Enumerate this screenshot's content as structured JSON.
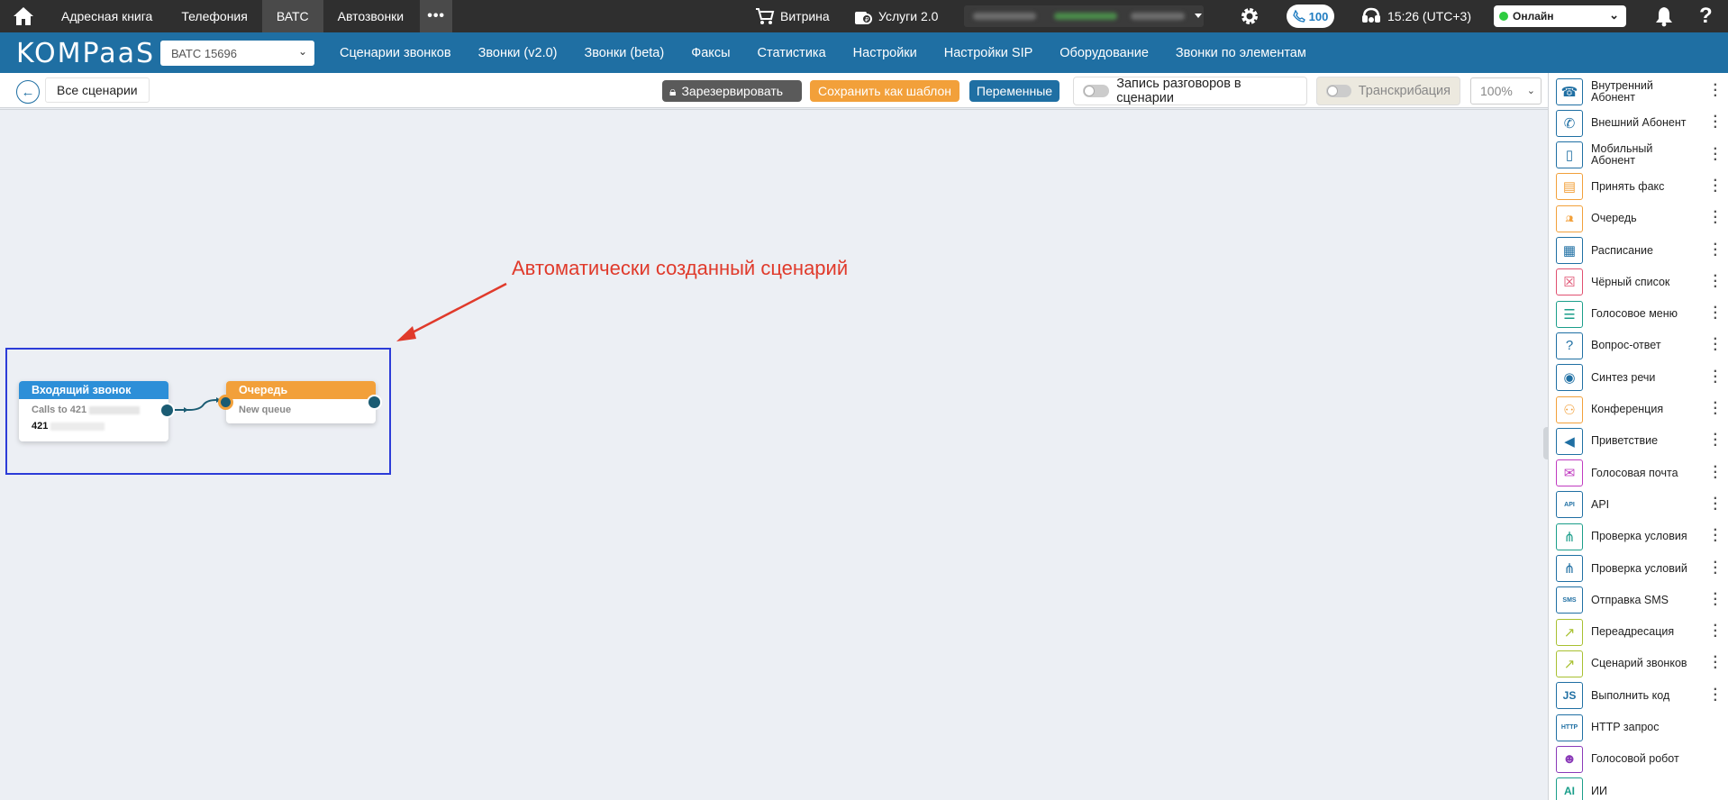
{
  "topbar": {
    "tabs": [
      {
        "label": "Адресная книга"
      },
      {
        "label": "Телефония"
      },
      {
        "label": "ВАТС"
      },
      {
        "label": "Автозвонки"
      }
    ],
    "more_label": "•••",
    "showcase_label": "Витрина",
    "services_label": "Услуги 2.0",
    "calls_count": "100",
    "time": "15:26 (UTC+3)",
    "status": "Онлайн"
  },
  "navbar": {
    "logo": "KOMPaaS",
    "pbx_select": "ВАТС 15696",
    "links": [
      {
        "label": "Сценарии звонков"
      },
      {
        "label": "Звонки (v2.0)"
      },
      {
        "label": "Звонки (beta)"
      },
      {
        "label": "Факсы"
      },
      {
        "label": "Статистика"
      },
      {
        "label": "Настройки"
      },
      {
        "label": "Настройки SIP"
      },
      {
        "label": "Оборудование"
      },
      {
        "label": "Звонки по элементам"
      }
    ]
  },
  "toolbar": {
    "all_scenarios": "Все сценарии",
    "reserve": "Зарезервировать",
    "save_template": "Сохранить как шаблон",
    "variables": "Переменные",
    "record_calls": "Запись разговоров в сценарии",
    "transcription": "Транскрибация",
    "zoom": "100%"
  },
  "canvas": {
    "annotation": "Автоматически созданный сценарий",
    "nodes": {
      "incoming": {
        "title": "Входящий звонок",
        "subtitle": "Calls to 421",
        "number": "421",
        "color": "#2d8fd8"
      },
      "queue": {
        "title": "Очередь",
        "subtitle": "New queue",
        "color": "#f2a03a"
      }
    }
  },
  "palette": {
    "items": [
      {
        "label": "Внутренний Абонент",
        "icon": "internal-subscriber-icon",
        "color": "#1f6fa3"
      },
      {
        "label": "Внешний Абонент",
        "icon": "external-subscriber-icon",
        "color": "#1f6fa3"
      },
      {
        "label": "Мобильный Абонент",
        "icon": "mobile-subscriber-icon",
        "color": "#1f6fa3"
      },
      {
        "label": "Принять факс",
        "icon": "fax-icon",
        "color": "#f2a03a"
      },
      {
        "label": "Очередь",
        "icon": "queue-icon",
        "color": "#f2a03a"
      },
      {
        "label": "Расписание",
        "icon": "schedule-icon",
        "color": "#1f6fa3"
      },
      {
        "label": "Чёрный список",
        "icon": "blacklist-icon",
        "color": "#e05070"
      },
      {
        "label": "Голосовое меню",
        "icon": "voice-menu-icon",
        "color": "#1a9e8a"
      },
      {
        "label": "Вопрос-ответ",
        "icon": "question-answer-icon",
        "color": "#1f6fa3"
      },
      {
        "label": "Синтез речи",
        "icon": "speech-synthesis-icon",
        "color": "#1f6fa3"
      },
      {
        "label": "Конференция",
        "icon": "conference-icon",
        "color": "#f2a03a"
      },
      {
        "label": "Приветствие",
        "icon": "greeting-icon",
        "color": "#1f6fa3"
      },
      {
        "label": "Голосовая почта",
        "icon": "voicemail-icon",
        "color": "#c03ac0"
      },
      {
        "label": "API",
        "icon": "api-icon",
        "color": "#1f6fa3"
      },
      {
        "label": "Проверка условия",
        "icon": "condition-icon",
        "color": "#1a9e8a"
      },
      {
        "label": "Проверка условий",
        "icon": "conditions-icon",
        "color": "#1f6fa3"
      },
      {
        "label": "Отправка SMS",
        "icon": "sms-icon",
        "color": "#1f6fa3"
      },
      {
        "label": "Переадресация",
        "icon": "redirect-icon",
        "color": "#a8c030"
      },
      {
        "label": "Сценарий звонков",
        "icon": "call-scenario-icon",
        "color": "#a8c030"
      },
      {
        "label": "Выполнить код",
        "icon": "js-code-icon",
        "color": "#1f6fa3"
      },
      {
        "label": "HTTP запрос",
        "icon": "http-request-icon",
        "color": "#1f6fa3"
      },
      {
        "label": "Голосовой робот",
        "icon": "voice-robot-icon",
        "color": "#8a3ab8"
      },
      {
        "label": "ИИ",
        "icon": "ai-icon",
        "color": "#1a9e8a"
      }
    ]
  }
}
